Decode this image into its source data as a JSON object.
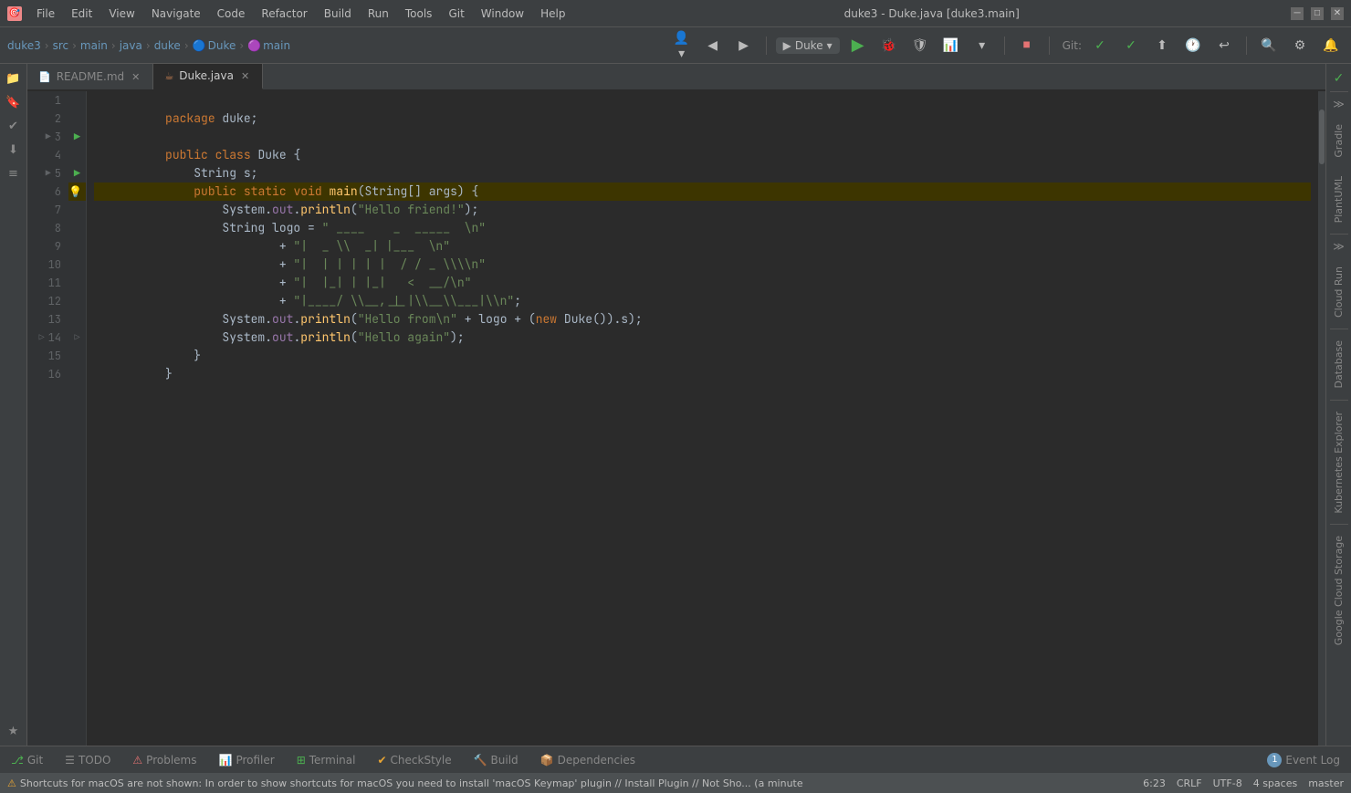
{
  "window": {
    "title": "duke3 - Duke.java [duke3.main]",
    "icon": "🎯"
  },
  "menu": {
    "items": [
      "File",
      "Edit",
      "View",
      "Navigate",
      "Code",
      "Refactor",
      "Build",
      "Run",
      "Tools",
      "Git",
      "Window",
      "Help"
    ]
  },
  "breadcrumb": {
    "items": [
      "duke3",
      "src",
      "main",
      "java",
      "duke",
      "Duke",
      "main"
    ]
  },
  "tabs": {
    "items": [
      {
        "label": "README.md",
        "type": "readme",
        "active": false
      },
      {
        "label": "Duke.java",
        "type": "java",
        "active": true
      }
    ]
  },
  "code": {
    "lines": [
      {
        "num": 1,
        "content": "package duke;",
        "type": "normal"
      },
      {
        "num": 2,
        "content": "",
        "type": "normal"
      },
      {
        "num": 3,
        "content": "public class Duke {",
        "type": "class"
      },
      {
        "num": 4,
        "content": "    String s;",
        "type": "normal"
      },
      {
        "num": 5,
        "content": "    public static void main(String[] args) {",
        "type": "method"
      },
      {
        "num": 6,
        "content": "        System.out.println(\"Hello friend!\");",
        "type": "highlighted"
      },
      {
        "num": 7,
        "content": "        String logo = \" ____    _  _____  \\n\"",
        "type": "normal"
      },
      {
        "num": 8,
        "content": "                + \"|  _ \\\\  _| |___  \\n\"",
        "type": "normal"
      },
      {
        "num": 9,
        "content": "                + \"|  | | | | |  / / _ \\\\\\\\n\"",
        "type": "normal"
      },
      {
        "num": 10,
        "content": "                + \"|  |_| | |_|   < __/\\n\"",
        "type": "normal"
      },
      {
        "num": 11,
        "content": "                + \"|____/ \\\\__,_|_|\\\\__\\___|\\n\";",
        "type": "normal"
      },
      {
        "num": 12,
        "content": "        System.out.println(\"Hello from\\n\" + logo + (new Duke()).s);",
        "type": "normal"
      },
      {
        "num": 13,
        "content": "        System.out.println(\"Hello again\");",
        "type": "normal"
      },
      {
        "num": 14,
        "content": "    }",
        "type": "normal"
      },
      {
        "num": 15,
        "content": "}",
        "type": "normal"
      },
      {
        "num": 16,
        "content": "",
        "type": "normal"
      }
    ]
  },
  "bottom_tabs": [
    {
      "label": "Git",
      "icon": "git"
    },
    {
      "label": "TODO",
      "icon": "todo"
    },
    {
      "label": "Problems",
      "icon": "problems"
    },
    {
      "label": "Profiler",
      "icon": "profiler"
    },
    {
      "label": "Terminal",
      "icon": "terminal"
    },
    {
      "label": "CheckStyle",
      "icon": "checkstyle"
    },
    {
      "label": "Build",
      "icon": "build"
    },
    {
      "label": "Dependencies",
      "icon": "deps"
    }
  ],
  "event_log": {
    "label": "Event Log",
    "count": "1"
  },
  "status_bar": {
    "warning": "Shortcuts for macOS are not shown: In order to show shortcuts for macOS you need to install 'macOS Keymap' plugin // Install Plugin // Not Sho... (a minute",
    "line_col": "6:23",
    "encoding": "CRLF",
    "charset": "UTF-8",
    "indent": "4 spaces",
    "branch": "master"
  },
  "right_panels": [
    "Gradle",
    "PlantUML",
    "Cloud Run",
    "Database",
    "Kubernetes Explorer",
    "Google Cloud Storage"
  ],
  "run_config": {
    "label": "Duke"
  }
}
